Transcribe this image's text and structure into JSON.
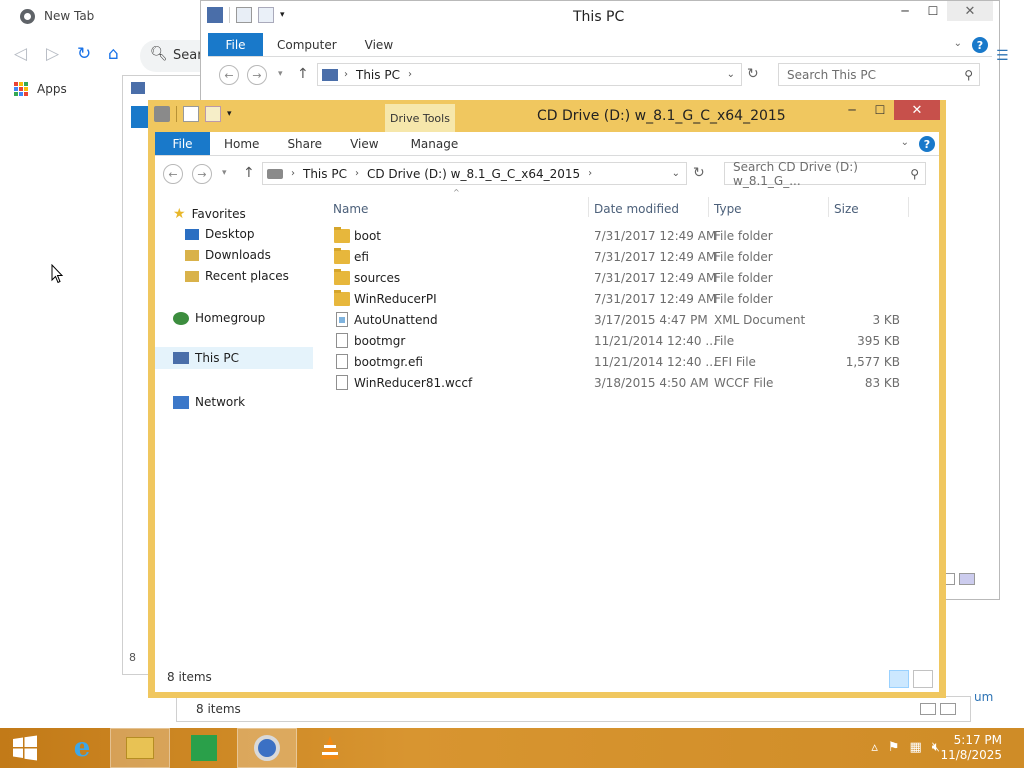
{
  "chrome": {
    "tab_title": "New Tab",
    "omnibox_text": "Sear",
    "apps_label": "Apps",
    "apps_colors": [
      "#ea4335",
      "#fbbc05",
      "#34a853",
      "#4285f4",
      "#ea4335",
      "#fbbc05",
      "#34a853",
      "#4285f4",
      "#ea4335"
    ]
  },
  "thispc": {
    "title": "This PC",
    "tabs": {
      "file": "File",
      "computer": "Computer",
      "view": "View"
    },
    "address": "This PC",
    "search_placeholder": "Search This PC"
  },
  "cd": {
    "title": "CD Drive (D:) w_8.1_G_C_x64_2015",
    "drive_tools": "Drive Tools",
    "tabs": {
      "file": "File",
      "home": "Home",
      "share": "Share",
      "view": "View",
      "manage": "Manage"
    },
    "breadcrumb": [
      "This PC",
      "CD Drive (D:) w_8.1_G_C_x64_2015"
    ],
    "search_placeholder": "Search CD Drive (D:) w_8.1_G_...",
    "nav": {
      "favorites": "Favorites",
      "desktop": "Desktop",
      "downloads": "Downloads",
      "recent": "Recent places",
      "homegroup": "Homegroup",
      "thispc": "This PC",
      "network": "Network"
    },
    "columns": {
      "name": "Name",
      "date": "Date modified",
      "type": "Type",
      "size": "Size"
    },
    "files": [
      {
        "name": "boot",
        "date": "7/31/2017 12:49 AM",
        "type": "File folder",
        "size": "",
        "icon": "folder-icon"
      },
      {
        "name": "efi",
        "date": "7/31/2017 12:49 AM",
        "type": "File folder",
        "size": "",
        "icon": "folder-icon"
      },
      {
        "name": "sources",
        "date": "7/31/2017 12:49 AM",
        "type": "File folder",
        "size": "",
        "icon": "folder-icon"
      },
      {
        "name": "WinReducerPI",
        "date": "7/31/2017 12:49 AM",
        "type": "File folder",
        "size": "",
        "icon": "folder-icon"
      },
      {
        "name": "AutoUnattend",
        "date": "3/17/2015 4:47 PM",
        "type": "XML Document",
        "size": "3 KB",
        "icon": "xml-file-icon"
      },
      {
        "name": "bootmgr",
        "date": "11/21/2014 12:40 ...",
        "type": "File",
        "size": "395 KB",
        "icon": "file-icon"
      },
      {
        "name": "bootmgr.efi",
        "date": "11/21/2014 12:40 ...",
        "type": "EFI File",
        "size": "1,577 KB",
        "icon": "file-icon"
      },
      {
        "name": "WinReducer81.wccf",
        "date": "3/18/2015 4:50 AM",
        "type": "WCCF File",
        "size": "83 KB",
        "icon": "file-icon"
      }
    ],
    "status": "8 items"
  },
  "bg_status": "8 items",
  "bg_um": "um",
  "taskbar": {
    "time": "5:17 PM",
    "date": "11/8/2025"
  }
}
